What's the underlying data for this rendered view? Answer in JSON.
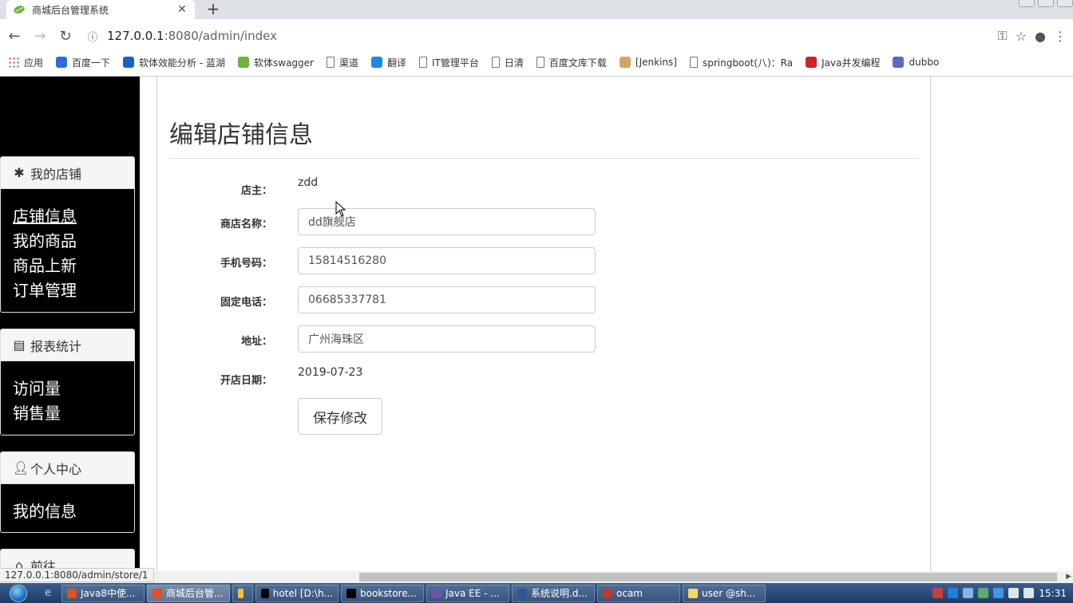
{
  "browser": {
    "tab_title": "商城后台管理系统",
    "url_host": "127.0.0.1",
    "url_path": ":8080/admin/index",
    "bookmarks": [
      {
        "label": "应用",
        "icon": "apps-grid-icon"
      },
      {
        "label": "百度一下",
        "icon": "baidu-paw-icon"
      },
      {
        "label": "软体效能分析 - 蓝湖",
        "icon": "lanhu-icon"
      },
      {
        "label": "软体swagger",
        "icon": "swagger-icon"
      },
      {
        "label": "渠道",
        "icon": "page-icon"
      },
      {
        "label": "翻译",
        "icon": "translate-icon"
      },
      {
        "label": "IT管理平台",
        "icon": "page-icon"
      },
      {
        "label": "日清",
        "icon": "page-icon"
      },
      {
        "label": "百度文库下载",
        "icon": "page-icon"
      },
      {
        "label": "[Jenkins]",
        "icon": "jenkins-icon"
      },
      {
        "label": "springboot(八)：Ra",
        "icon": "cloud-icon"
      },
      {
        "label": "Java并发编程",
        "icon": "csdn-icon"
      },
      {
        "label": "dubbo",
        "icon": "dubbo-icon"
      }
    ],
    "status_url": "127.0.0.1:8080/admin/store/1"
  },
  "sidebar": {
    "store_panel": {
      "title": "我的店铺",
      "icon": "asterisk-icon",
      "links": [
        "店铺信息",
        "我的商品",
        "商品上新",
        "订单管理"
      ]
    },
    "report_panel": {
      "title": "报表统计",
      "icon": "list-alt-icon",
      "links": [
        "访问量",
        "销售量"
      ]
    },
    "profile_panel": {
      "title": "个人中心",
      "icon": "user-icon",
      "links": [
        "我的信息"
      ]
    },
    "goto_panel": {
      "title": "前往",
      "icon": "home-icon"
    }
  },
  "main": {
    "title": "编辑店铺信息",
    "owner_label": "店主：",
    "owner_value": "zdd",
    "store_name_label": "商店名称：",
    "store_name_value": "dd旗舰店",
    "phone_label": "手机号码：",
    "phone_value": "15814516280",
    "tel_label": "固定电话：",
    "tel_value": "06685337781",
    "address_label": "地址：",
    "address_value": "广州海珠区",
    "open_date_label": "开店日期：",
    "open_date_value": "2019-07-23",
    "save_label": "保存修改"
  },
  "taskbar": {
    "tasks": [
      {
        "label": "Java8中使...",
        "color": "#e44d26"
      },
      {
        "label": "商城后台管...",
        "color": "#e44d26"
      },
      {
        "label": "",
        "color": "#f0c040"
      },
      {
        "label": "hotel [D:\\h...",
        "color": "#000000"
      },
      {
        "label": "bookstore...",
        "color": "#000000"
      },
      {
        "label": "Java EE - ...",
        "color": "#6b57a5"
      },
      {
        "label": "系统说明.d...",
        "color": "#2b5797"
      },
      {
        "label": "ocam",
        "color": "#c0392b"
      },
      {
        "label": "user @sh...",
        "color": "#f5d76e"
      }
    ],
    "clock": "15:31"
  }
}
